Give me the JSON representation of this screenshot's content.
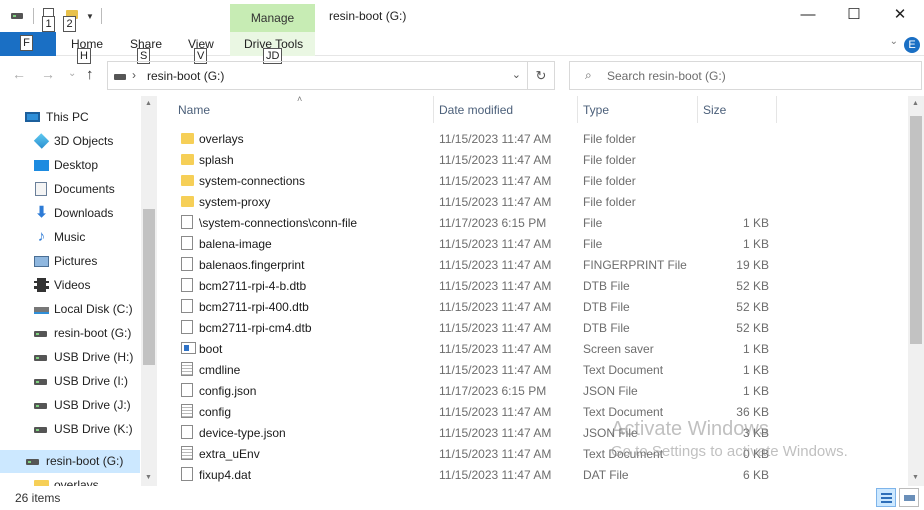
{
  "window": {
    "title": "resin-boot (G:)",
    "minimize": "—",
    "maximize": "☐",
    "close": "✕"
  },
  "quick_access": {
    "keytip_1": "1",
    "keytip_2": "2"
  },
  "ribbon": {
    "manage_label": "Manage",
    "file_keytip": "F",
    "tabs": [
      {
        "label": "Home",
        "keytip": "H"
      },
      {
        "label": "Share",
        "keytip": "S"
      },
      {
        "label": "View",
        "keytip": "V"
      },
      {
        "label": "Drive Tools",
        "keytip": "JD"
      }
    ],
    "expand_chevron": "⌄",
    "help_keytip": "E"
  },
  "address_bar": {
    "back": "←",
    "forward": "→",
    "recent": "⌄",
    "up": "↑",
    "chevron": "›",
    "path": "resin-boot (G:)",
    "dropdown": "⌄",
    "refresh": "↻"
  },
  "search": {
    "placeholder": "Search resin-boot (G:)",
    "icon": "⌕"
  },
  "nav_pane": {
    "items": [
      {
        "label": "This PC",
        "icon": "computer-icon"
      },
      {
        "label": "3D Objects",
        "icon": "3d-objects-icon"
      },
      {
        "label": "Desktop",
        "icon": "desktop-icon"
      },
      {
        "label": "Documents",
        "icon": "documents-icon"
      },
      {
        "label": "Downloads",
        "icon": "downloads-icon"
      },
      {
        "label": "Music",
        "icon": "music-icon"
      },
      {
        "label": "Pictures",
        "icon": "pictures-icon"
      },
      {
        "label": "Videos",
        "icon": "videos-icon"
      },
      {
        "label": "Local Disk (C:)",
        "icon": "local-disk-icon"
      },
      {
        "label": "resin-boot (G:)",
        "icon": "usb-drive-icon"
      },
      {
        "label": "USB Drive (H:)",
        "icon": "usb-drive-icon"
      },
      {
        "label": "USB Drive (I:)",
        "icon": "usb-drive-icon"
      },
      {
        "label": "USB Drive (J:)",
        "icon": "usb-drive-icon"
      },
      {
        "label": "USB Drive (K:)",
        "icon": "usb-drive-icon"
      },
      {
        "label": "resin-boot (G:)",
        "icon": "usb-drive-icon",
        "selected": true
      },
      {
        "label": "overlays",
        "icon": "folder-icon"
      }
    ]
  },
  "file_list": {
    "columns": {
      "name": "Name",
      "date": "Date modified",
      "type": "Type",
      "size": "Size"
    },
    "sort_caret": "˄",
    "rows": [
      {
        "name": "overlays",
        "date": "11/15/2023 11:47 AM",
        "type": "File folder",
        "size": "",
        "icon": "folder"
      },
      {
        "name": "splash",
        "date": "11/15/2023 11:47 AM",
        "type": "File folder",
        "size": "",
        "icon": "folder"
      },
      {
        "name": "system-connections",
        "date": "11/15/2023 11:47 AM",
        "type": "File folder",
        "size": "",
        "icon": "folder"
      },
      {
        "name": "system-proxy",
        "date": "11/15/2023 11:47 AM",
        "type": "File folder",
        "size": "",
        "icon": "folder"
      },
      {
        "name": "\\system-connections\\conn-file",
        "date": "11/17/2023 6:15 PM",
        "type": "File",
        "size": "1 KB",
        "icon": "file"
      },
      {
        "name": "balena-image",
        "date": "11/15/2023 11:47 AM",
        "type": "File",
        "size": "1 KB",
        "icon": "file"
      },
      {
        "name": "balenaos.fingerprint",
        "date": "11/15/2023 11:47 AM",
        "type": "FINGERPRINT File",
        "size": "19 KB",
        "icon": "file"
      },
      {
        "name": "bcm2711-rpi-4-b.dtb",
        "date": "11/15/2023 11:47 AM",
        "type": "DTB File",
        "size": "52 KB",
        "icon": "file"
      },
      {
        "name": "bcm2711-rpi-400.dtb",
        "date": "11/15/2023 11:47 AM",
        "type": "DTB File",
        "size": "52 KB",
        "icon": "file"
      },
      {
        "name": "bcm2711-rpi-cm4.dtb",
        "date": "11/15/2023 11:47 AM",
        "type": "DTB File",
        "size": "52 KB",
        "icon": "file"
      },
      {
        "name": "boot",
        "date": "11/15/2023 11:47 AM",
        "type": "Screen saver",
        "size": "1 KB",
        "icon": "screensaver"
      },
      {
        "name": "cmdline",
        "date": "11/15/2023 11:47 AM",
        "type": "Text Document",
        "size": "1 KB",
        "icon": "text"
      },
      {
        "name": "config.json",
        "date": "11/17/2023 6:15 PM",
        "type": "JSON File",
        "size": "1 KB",
        "icon": "file"
      },
      {
        "name": "config",
        "date": "11/15/2023 11:47 AM",
        "type": "Text Document",
        "size": "36 KB",
        "icon": "text"
      },
      {
        "name": "device-type.json",
        "date": "11/15/2023 11:47 AM",
        "type": "JSON File",
        "size": "3 KB",
        "icon": "file"
      },
      {
        "name": "extra_uEnv",
        "date": "11/15/2023 11:47 AM",
        "type": "Text Document",
        "size": "0 KB",
        "icon": "text"
      },
      {
        "name": "fixup4.dat",
        "date": "11/15/2023 11:47 AM",
        "type": "DAT File",
        "size": "6 KB",
        "icon": "file"
      }
    ]
  },
  "watermark": {
    "line1": "Activate Windows",
    "line2": "Go to Settings to activate Windows."
  },
  "status_bar": {
    "item_count": "26 items"
  }
}
